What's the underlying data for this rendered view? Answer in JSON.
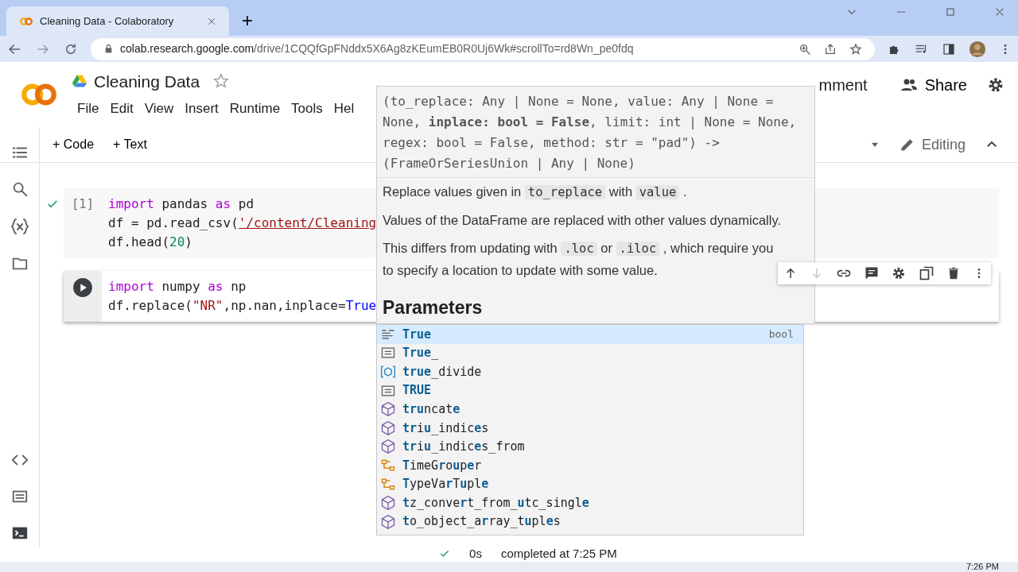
{
  "browser": {
    "tab_title": "Cleaning Data - Colaboratory",
    "new_tab": "+",
    "url_host": "colab.research.google.com",
    "url_path": "/drive/1CQQfGpFNddx5X6Ag8zKEumEB0R0Uj6Wk#scrollTo=rd8Wn_pe0fdq"
  },
  "notebook": {
    "title": "Cleaning Data",
    "starred": false,
    "menu": [
      "File",
      "Edit",
      "View",
      "Insert",
      "Runtime",
      "Tools",
      "Hel"
    ],
    "comment_button": "mment",
    "share_button": "Share"
  },
  "toolbar": {
    "add_code": "+ Code",
    "add_text": "+ Text",
    "mode": "Editing"
  },
  "cells": [
    {
      "kind": "executed",
      "prompt": "[1]",
      "lines": [
        [
          {
            "kind": "keyword",
            "text": "import"
          },
          {
            "kind": "plain",
            "text": " pandas "
          },
          {
            "kind": "keyword",
            "text": "as"
          },
          {
            "kind": "plain",
            "text": " pd"
          }
        ],
        [
          {
            "kind": "plain",
            "text": "df = pd.read_csv("
          },
          {
            "kind": "path",
            "text": "'/content/Cleaning"
          }
        ],
        [
          {
            "kind": "plain",
            "text": "df.head("
          },
          {
            "kind": "number",
            "text": "20"
          },
          {
            "kind": "plain",
            "text": ")"
          }
        ]
      ]
    },
    {
      "kind": "active",
      "lines": [
        [
          {
            "kind": "keyword",
            "text": "import"
          },
          {
            "kind": "plain",
            "text": " numpy "
          },
          {
            "kind": "keyword",
            "text": "as"
          },
          {
            "kind": "plain",
            "text": " np"
          }
        ],
        [
          {
            "kind": "plain",
            "text": "df.replace("
          },
          {
            "kind": "string",
            "text": "\"NR\""
          },
          {
            "kind": "plain",
            "text": ",np.nan,inplace="
          },
          {
            "kind": "constant",
            "text": "True"
          }
        ]
      ]
    }
  ],
  "cell_toolbar": {
    "move_down_disabled": true
  },
  "signature": "(to_replace: Any | None = None, value: Any | None = None, **inplace: bool = False**, limit: int | None = None, regex: bool = False, method: str = \"pad\") -> (FrameOrSeriesUnion | Any | None)",
  "doc_paragraphs": [
    [
      {
        "kind": "text",
        "text": "Replace values given in "
      },
      {
        "kind": "code",
        "text": "to_replace"
      },
      {
        "kind": "text",
        "text": " with "
      },
      {
        "kind": "code",
        "text": "value"
      },
      {
        "kind": "text",
        "text": " ."
      }
    ],
    [
      {
        "kind": "text",
        "text": "Values of the DataFrame are replaced with other values dynamically."
      }
    ],
    [
      {
        "kind": "text",
        "text": "This differs from updating with "
      },
      {
        "kind": "code",
        "text": ".loc"
      },
      {
        "kind": "text",
        "text": " or "
      },
      {
        "kind": "code",
        "text": ".iloc"
      },
      {
        "kind": "text",
        "text": " , which require you to specify a location to update with some value."
      }
    ]
  ],
  "doc_heading": "Parameters",
  "completions": [
    {
      "label": "**True**",
      "kind": "variable",
      "selected": true,
      "detail": "bool"
    },
    {
      "label": "**True**_",
      "kind": "constant",
      "selected": false
    },
    {
      "label": "**true**_divide",
      "kind": "function",
      "selected": false
    },
    {
      "label": "**TRUE**",
      "kind": "constant",
      "selected": false
    },
    {
      "label": "**tru**ncat**e**",
      "kind": "module",
      "selected": false
    },
    {
      "label": "**tr**i**u**_indic**e**s",
      "kind": "module",
      "selected": false
    },
    {
      "label": "**tr**i**u**_indic**e**s_from",
      "kind": "module",
      "selected": false
    },
    {
      "label": "**T**imeG**r**o**u**p**e**r",
      "kind": "class",
      "selected": false
    },
    {
      "label": "**T**ypeVa**r**T**u**pl**e**",
      "kind": "class",
      "selected": false
    },
    {
      "label": "**t**z_conve**r**t_from_**u**tc_singl**e**",
      "kind": "module",
      "selected": false
    },
    {
      "label": "**t**o_object_a**r**ray_t**u**pl**e**s",
      "kind": "module",
      "selected": false
    }
  ],
  "status": {
    "duration": "0s",
    "message": "completed at 7:25 PM",
    "ok": true
  },
  "taskbar": {
    "time": "7:26 PM"
  }
}
